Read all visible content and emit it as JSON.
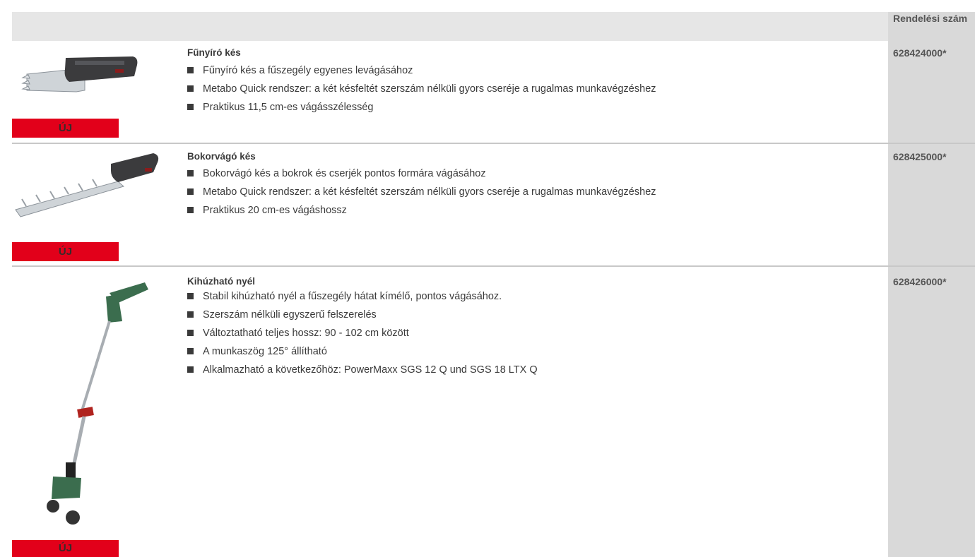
{
  "header": {
    "order_label": "Rendelési szám"
  },
  "products": [
    {
      "title": "Fűnyíró kés",
      "bullets": [
        "Fűnyíró kés a fűszegély egyenes levágásához",
        "Metabo Quick rendszer: a két késfeltét szerszám nélküli gyors cseréje a rugalmas munkavégzéshez",
        "Praktikus 11,5 cm-es vágásszélesség"
      ],
      "order_no": "628424000*",
      "badge": "ÚJ",
      "image": "grass-shear-blade"
    },
    {
      "title": "Bokorvágó kés",
      "bullets": [
        "Bokorvágó kés a bokrok és cserjék pontos formára vágásához",
        "Metabo Quick rendszer: a két késfeltét szerszám nélküli gyors cseréje a rugalmas munkavégzéshez",
        "Praktikus 20 cm-es vágáshossz"
      ],
      "order_no": "628425000*",
      "badge": "ÚJ",
      "image": "shrub-shear-blade"
    },
    {
      "title": "Kihúzható nyél",
      "bullets": [
        "Stabil kihúzható nyél a fűszegély hátat kímélő, pontos vágásához.",
        "Szerszám nélküli egyszerű felszerelés",
        "Változtatható teljes hossz: 90 - 102 cm között",
        "A munkaszög 125° állítható",
        "Alkalmazható a következőhöz: PowerMaxx SGS 12 Q und SGS 18 LTX Q"
      ],
      "order_no": "628426000*",
      "badge": "ÚJ",
      "image": "telescopic-handle"
    }
  ],
  "colors": {
    "badge": "#e2001a",
    "header_bg": "#e6e6e6",
    "order_col_bg": "#d9d9d9"
  }
}
